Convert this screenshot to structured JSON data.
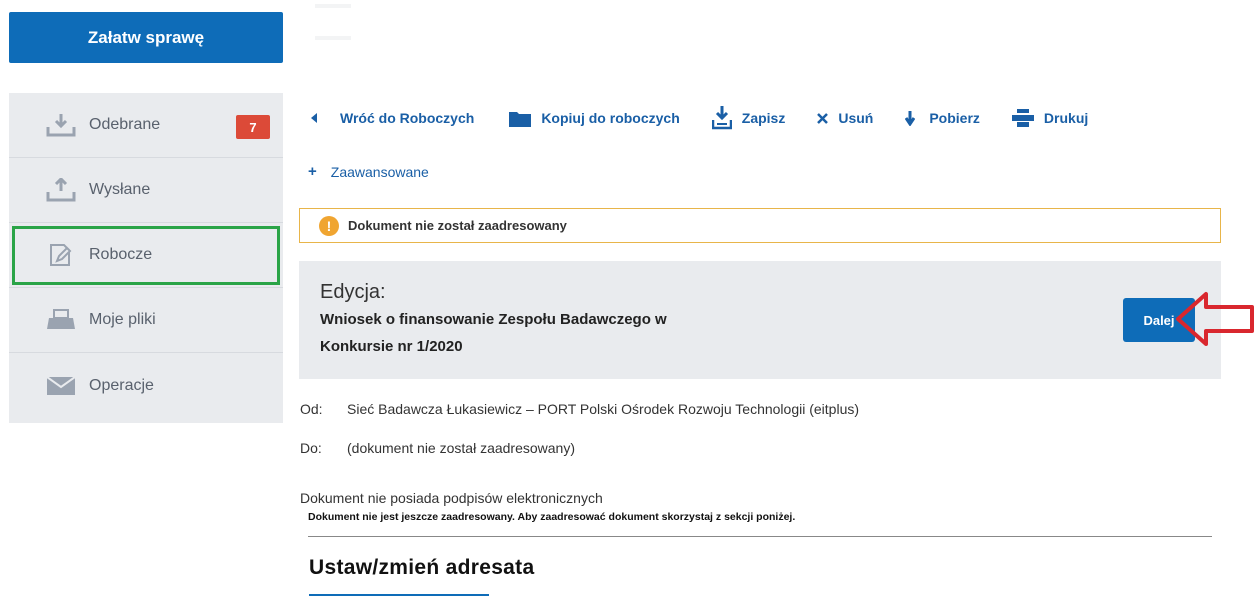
{
  "primary_button": {
    "label": "Załatw sprawę"
  },
  "sidebar": {
    "items": [
      {
        "label": "Odebrane",
        "icon": "download-tray-icon",
        "badge": "7"
      },
      {
        "label": "Wysłane",
        "icon": "upload-tray-icon"
      },
      {
        "label": "Robocze",
        "icon": "edit-document-icon",
        "highlighted": true
      },
      {
        "label": "Moje pliki",
        "icon": "file-tray-icon"
      },
      {
        "label": "Operacje",
        "icon": "envelope-icon"
      }
    ]
  },
  "toolbar": {
    "items": [
      {
        "label": "Wróć do Roboczych",
        "icon": "caret-left-icon"
      },
      {
        "label": "Kopiuj do roboczych",
        "icon": "folder-icon"
      },
      {
        "label": "Zapisz",
        "icon": "save-download-icon"
      },
      {
        "label": "Usuń",
        "icon": "close-icon"
      },
      {
        "label": "Pobierz",
        "icon": "arrow-down-icon"
      },
      {
        "label": "Drukuj",
        "icon": "print-icon"
      }
    ]
  },
  "advanced": {
    "label": "Zaawansowane",
    "icon_text": "+"
  },
  "alert": {
    "icon_text": "!",
    "text": "Dokument nie został zaadresowany"
  },
  "edit": {
    "title": "Edycja:",
    "document_line1": "Wniosek o finansowanie Zespołu Badawczego w",
    "document_line2": "Konkursie nr 1/2020",
    "next_label": "Dalej"
  },
  "meta": {
    "from_label": "Od:",
    "from_value": "Sieć Badawcza Łukasiewicz – PORT Polski Ośrodek Rozwoju Technologii (eitplus)",
    "to_label": "Do:",
    "to_value": "(dokument nie został zaadresowany)"
  },
  "signatures_text": "Dokument nie posiada podpisów elektronicznych",
  "address_note": "Dokument nie jest jeszcze zaadresowany. Aby zaadresować dokument skorzystaj z sekcji poniżej.",
  "section_title": "Ustaw/zmień adresata",
  "colors": {
    "primary": "#0e6cb8",
    "link": "#1a5fa6",
    "badge": "#dc4a38",
    "highlight": "#2aa447",
    "annotation_arrow": "#d9272e",
    "alert_border": "#e8b54a"
  }
}
